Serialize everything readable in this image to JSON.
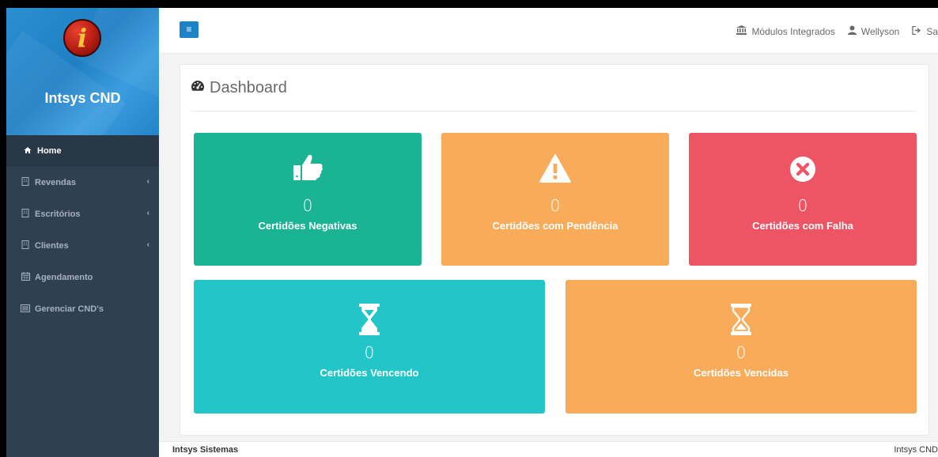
{
  "brand": {
    "logo_letter": "i",
    "title": "Intsys CND"
  },
  "sidebar": {
    "items": [
      {
        "label": "Home",
        "icon": "home-icon",
        "active": true,
        "chevron": false
      },
      {
        "label": "Revendas",
        "icon": "building-icon",
        "active": false,
        "chevron": true
      },
      {
        "label": "Escritórios",
        "icon": "building-icon",
        "active": false,
        "chevron": true
      },
      {
        "label": "Clientes",
        "icon": "building-icon",
        "active": false,
        "chevron": true
      },
      {
        "label": "Agendamento",
        "icon": "calendar-icon",
        "active": false,
        "chevron": false
      },
      {
        "label": "Gerenciar CND's",
        "icon": "list-icon",
        "active": false,
        "chevron": false
      }
    ]
  },
  "topbar": {
    "menu_icon": "hamburger-icon",
    "links": [
      {
        "label": "Módulos Integrados",
        "icon": "institution-icon"
      },
      {
        "label": "Wellyson",
        "icon": "user-icon"
      },
      {
        "label": "Sa",
        "icon": "sign-out-icon"
      }
    ]
  },
  "dashboard": {
    "title": "Dashboard",
    "title_icon": "dashboard-icon",
    "cards": [
      {
        "count": "0",
        "label": "Certidões Negativas",
        "icon": "thumbs-up-icon",
        "color": "#1ab394"
      },
      {
        "count": "0",
        "label": "Certidões com Pendência",
        "icon": "warning-icon",
        "color": "#f8ac59"
      },
      {
        "count": "0",
        "label": "Certidões com Falha",
        "icon": "times-circle-icon",
        "color": "#ed5565"
      },
      {
        "count": "0",
        "label": "Certidões Vencendo",
        "icon": "hourglass-icon",
        "color": "#23c6c8"
      },
      {
        "count": "0",
        "label": "Certidões Vencidas",
        "icon": "hourglass-half-icon",
        "color": "#f8ac59"
      }
    ]
  },
  "footer": {
    "left": "Intsys Sistemas",
    "right": "Intsys CND"
  }
}
